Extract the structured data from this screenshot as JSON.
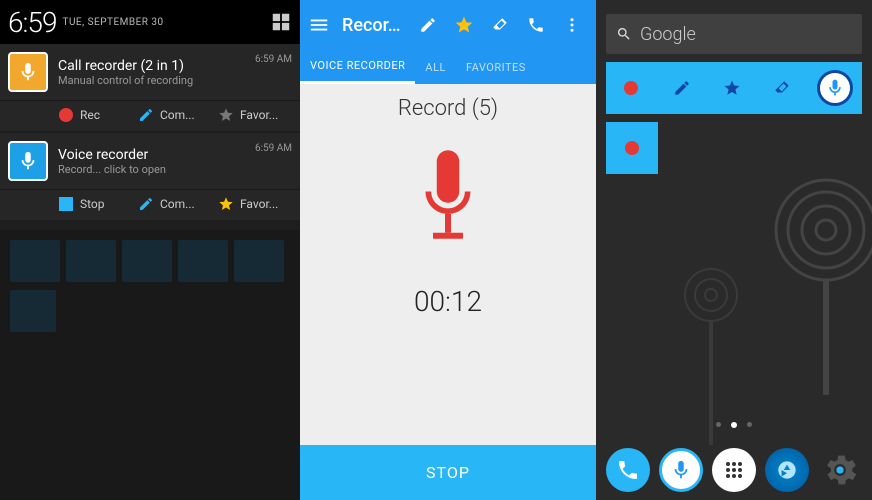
{
  "panel1": {
    "time": "6:59",
    "date": "TUE, SEPTEMBER 30",
    "notifications": [
      {
        "title": "Call recorder (2 in 1)",
        "subtitle": "Manual control of recording",
        "timestamp": "6:59 AM",
        "icon_color": "gold",
        "actions": [
          {
            "icon": "red-dot",
            "label": "Rec"
          },
          {
            "icon": "pencil",
            "label": "Com..."
          },
          {
            "icon": "star-grey",
            "label": "Favor..."
          }
        ]
      },
      {
        "title": "Voice recorder",
        "subtitle": "Record... click to open",
        "timestamp": "6:59 AM",
        "icon_color": "blue",
        "actions": [
          {
            "icon": "blue-square",
            "label": "Stop"
          },
          {
            "icon": "pencil",
            "label": "Com..."
          },
          {
            "icon": "star-gold",
            "label": "Favor..."
          }
        ]
      }
    ]
  },
  "panel2": {
    "app_name": "Recor...",
    "tabs": [
      "VOICE RECORDER",
      "ALL",
      "FAVORITES"
    ],
    "active_tab_index": 0,
    "record_title": "Record (5)",
    "timer": "00:12",
    "stop_label": "STOP",
    "toolbar_icons": [
      "pencil",
      "star",
      "eraser",
      "receiver",
      "overflow"
    ]
  },
  "panel3": {
    "search_label": "Google",
    "widget_row_icons": [
      "red-dot",
      "pencil",
      "star",
      "eraser",
      "mic"
    ],
    "single_widget_icon": "red-dot",
    "dock_icons": [
      "phone",
      "mic",
      "apps",
      "camera",
      "settings"
    ]
  }
}
